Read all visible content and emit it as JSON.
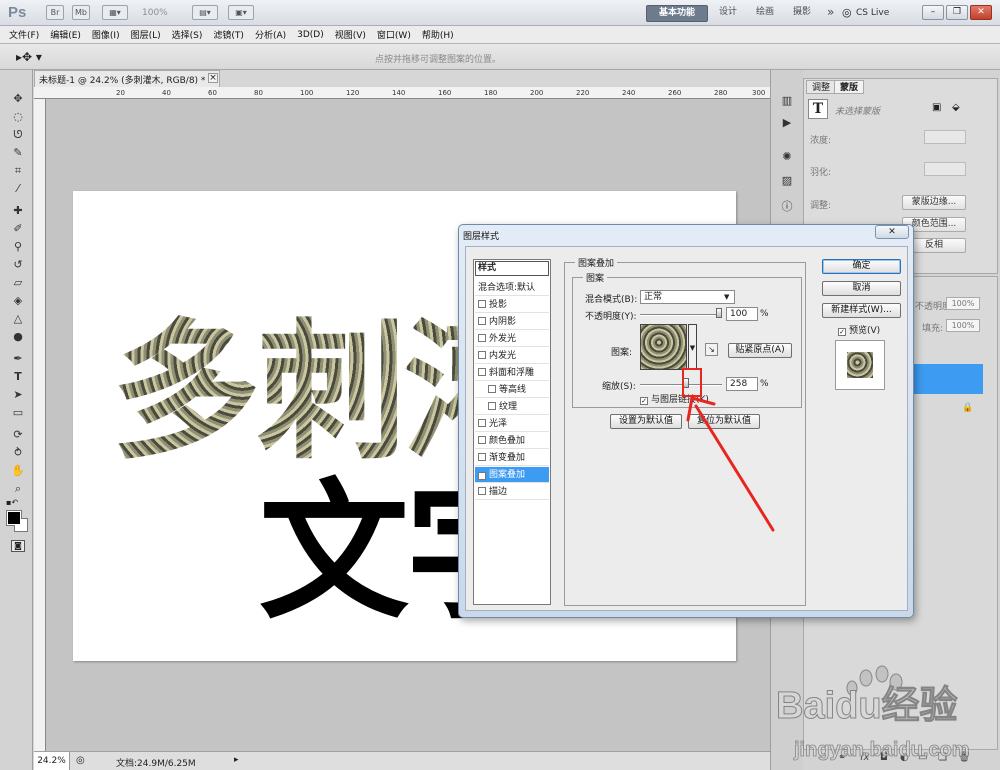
{
  "app": {
    "logo": "Ps",
    "zoom": "100%",
    "workspaces": [
      "基本功能",
      "设计",
      "绘画",
      "摄影"
    ],
    "more": "»",
    "cslive": "CS Live"
  },
  "menu": [
    "文件(F)",
    "编辑(E)",
    "图像(I)",
    "图层(L)",
    "选择(S)",
    "滤镜(T)",
    "分析(A)",
    "3D(D)",
    "视图(V)",
    "窗口(W)",
    "帮助(H)"
  ],
  "options": {
    "hint": "点按并拖移可调整图案的位置。"
  },
  "document": {
    "tab": "未标题-1 @ 24.2% (多刺灌木, RGB/8) *",
    "close": "×",
    "line1": "多刺灌",
    "line2": "文字",
    "ruler_ticks": [
      "20",
      "40",
      "60",
      "80",
      "100",
      "120",
      "140",
      "160",
      "180",
      "200",
      "220",
      "240",
      "260",
      "280",
      "300"
    ]
  },
  "status": {
    "zoom": "24.2%",
    "doc": "文档:24.9M/6.25M"
  },
  "panels": {
    "tabs": [
      "调整",
      "蒙版"
    ],
    "mask_desc": "未选择蒙版",
    "density": "浓度:",
    "feather": "羽化:",
    "refine": "调整:",
    "btn_mask_edge": "蒙版边缘...",
    "btn_color_range": "颜色范围...",
    "btn_invert": "反相",
    "opacity_lbl": "不透明度:",
    "opacity_val": "100%",
    "fill_lbl": "填充:",
    "fill_val": "100%"
  },
  "dialog": {
    "title": "图层样式",
    "close": "✕",
    "styles_header": "样式",
    "styles": [
      {
        "label": "混合选项:默认",
        "check": false,
        "hasCheck": false,
        "sub": false,
        "active": false
      },
      {
        "label": "投影",
        "check": false,
        "hasCheck": true,
        "sub": false,
        "active": false
      },
      {
        "label": "内阴影",
        "check": false,
        "hasCheck": true,
        "sub": false,
        "active": false
      },
      {
        "label": "外发光",
        "check": false,
        "hasCheck": true,
        "sub": false,
        "active": false
      },
      {
        "label": "内发光",
        "check": false,
        "hasCheck": true,
        "sub": false,
        "active": false
      },
      {
        "label": "斜面和浮雕",
        "check": false,
        "hasCheck": true,
        "sub": false,
        "active": false
      },
      {
        "label": "等高线",
        "check": false,
        "hasCheck": true,
        "sub": true,
        "active": false
      },
      {
        "label": "纹理",
        "check": false,
        "hasCheck": true,
        "sub": true,
        "active": false
      },
      {
        "label": "光泽",
        "check": false,
        "hasCheck": true,
        "sub": false,
        "active": false
      },
      {
        "label": "颜色叠加",
        "check": false,
        "hasCheck": true,
        "sub": false,
        "active": false
      },
      {
        "label": "渐变叠加",
        "check": false,
        "hasCheck": true,
        "sub": false,
        "active": false
      },
      {
        "label": "图案叠加",
        "check": true,
        "hasCheck": true,
        "sub": false,
        "active": true
      },
      {
        "label": "描边",
        "check": false,
        "hasCheck": true,
        "sub": false,
        "active": false
      }
    ],
    "group_title": "图案叠加",
    "subgroup_title": "图案",
    "blend_label": "混合模式(B):",
    "blend_value": "正常",
    "opacity_label": "不透明度(Y):",
    "opacity_value": "100",
    "opacity_level": 1.0,
    "pattern_label": "图案:",
    "snap_btn": "贴紧原点(A)",
    "scale_label": "缩放(S):",
    "scale_value": "258",
    "scale_level": 0.258,
    "percent": "%",
    "link_label": "与图层链接(K)",
    "link_checked": "✓",
    "btn_set_default": "设置为默认值",
    "btn_reset_default": "复位为默认值",
    "btn_ok": "确定",
    "btn_cancel": "取消",
    "btn_new_style": "新建样式(W)...",
    "preview_label": "预览(V)",
    "preview_checked": "✓"
  },
  "watermark": {
    "brand": "Baidu经验",
    "url": "jingyan.baidu.com"
  },
  "colors": {
    "highlight": "#e8261f",
    "selection": "#3d9bf2",
    "dialog_border": "#6d8aa8"
  }
}
